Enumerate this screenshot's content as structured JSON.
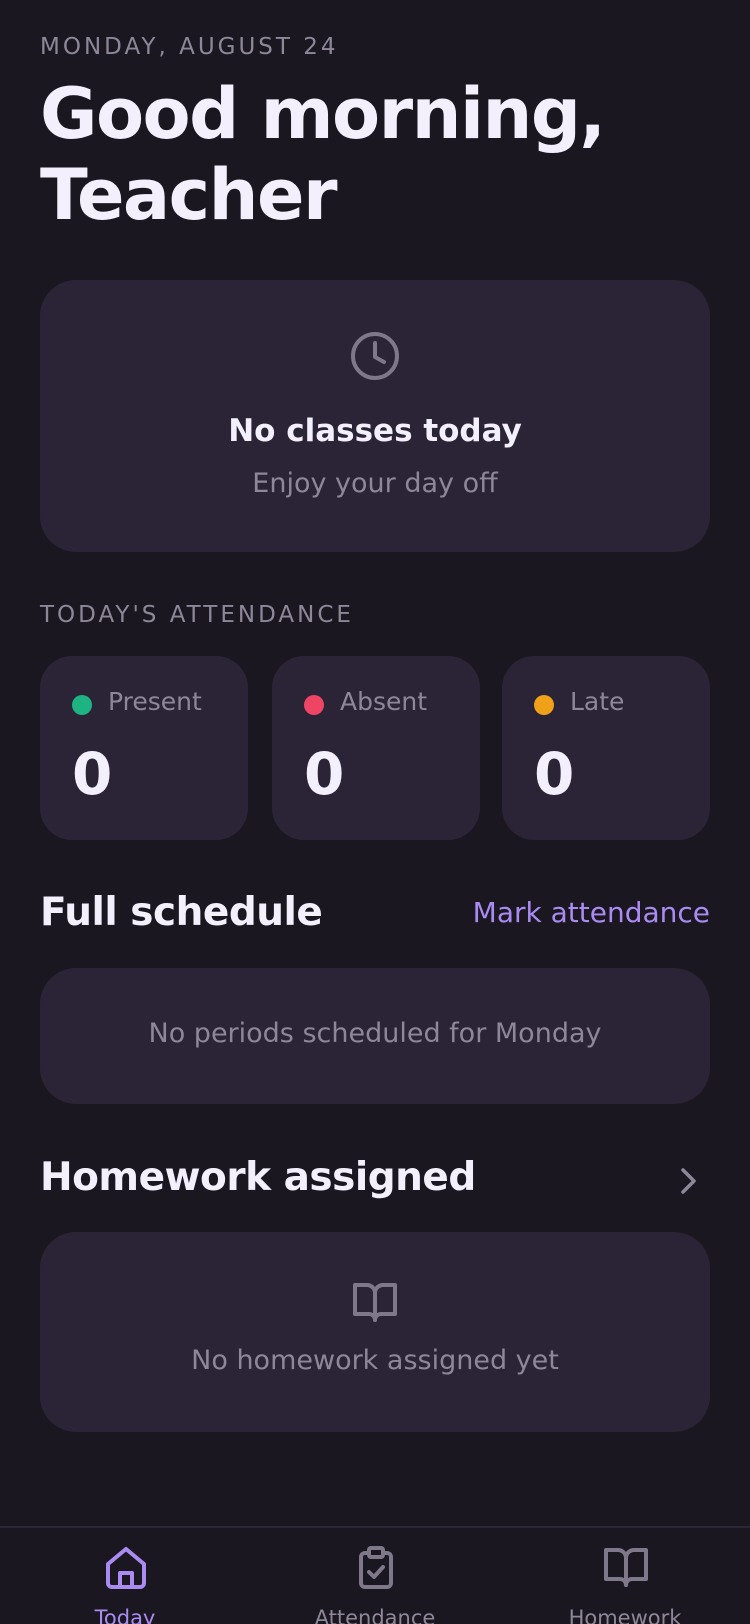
{
  "header": {
    "date": "MONDAY, AUGUST 24",
    "greeting": "Good morning, Teacher"
  },
  "today_card": {
    "icon": "clock-icon",
    "title": "No classes today",
    "subtitle": "Enjoy your day off"
  },
  "attendance": {
    "section_label": "TODAY'S ATTENDANCE",
    "stats": [
      {
        "label": "Present",
        "value": "0",
        "color": "#1db383"
      },
      {
        "label": "Absent",
        "value": "0",
        "color": "#ef4565"
      },
      {
        "label": "Late",
        "value": "0",
        "color": "#f0a11a"
      }
    ]
  },
  "schedule": {
    "title": "Full schedule",
    "action": "Mark attendance",
    "empty_text": "No periods scheduled for Monday"
  },
  "homework": {
    "title": "Homework assigned",
    "icon": "book-open-icon",
    "empty_text": "No homework assigned yet"
  },
  "tabbar": {
    "tabs": [
      {
        "label": "Today",
        "icon": "home-icon",
        "active": true
      },
      {
        "label": "Attendance",
        "icon": "clipboard-check-icon",
        "active": false
      },
      {
        "label": "Homework",
        "icon": "book-open-icon",
        "active": false
      }
    ]
  },
  "colors": {
    "background": "#1b1720",
    "card": "#2b2436",
    "accent": "#a98bf2",
    "muted": "#8e8799"
  }
}
